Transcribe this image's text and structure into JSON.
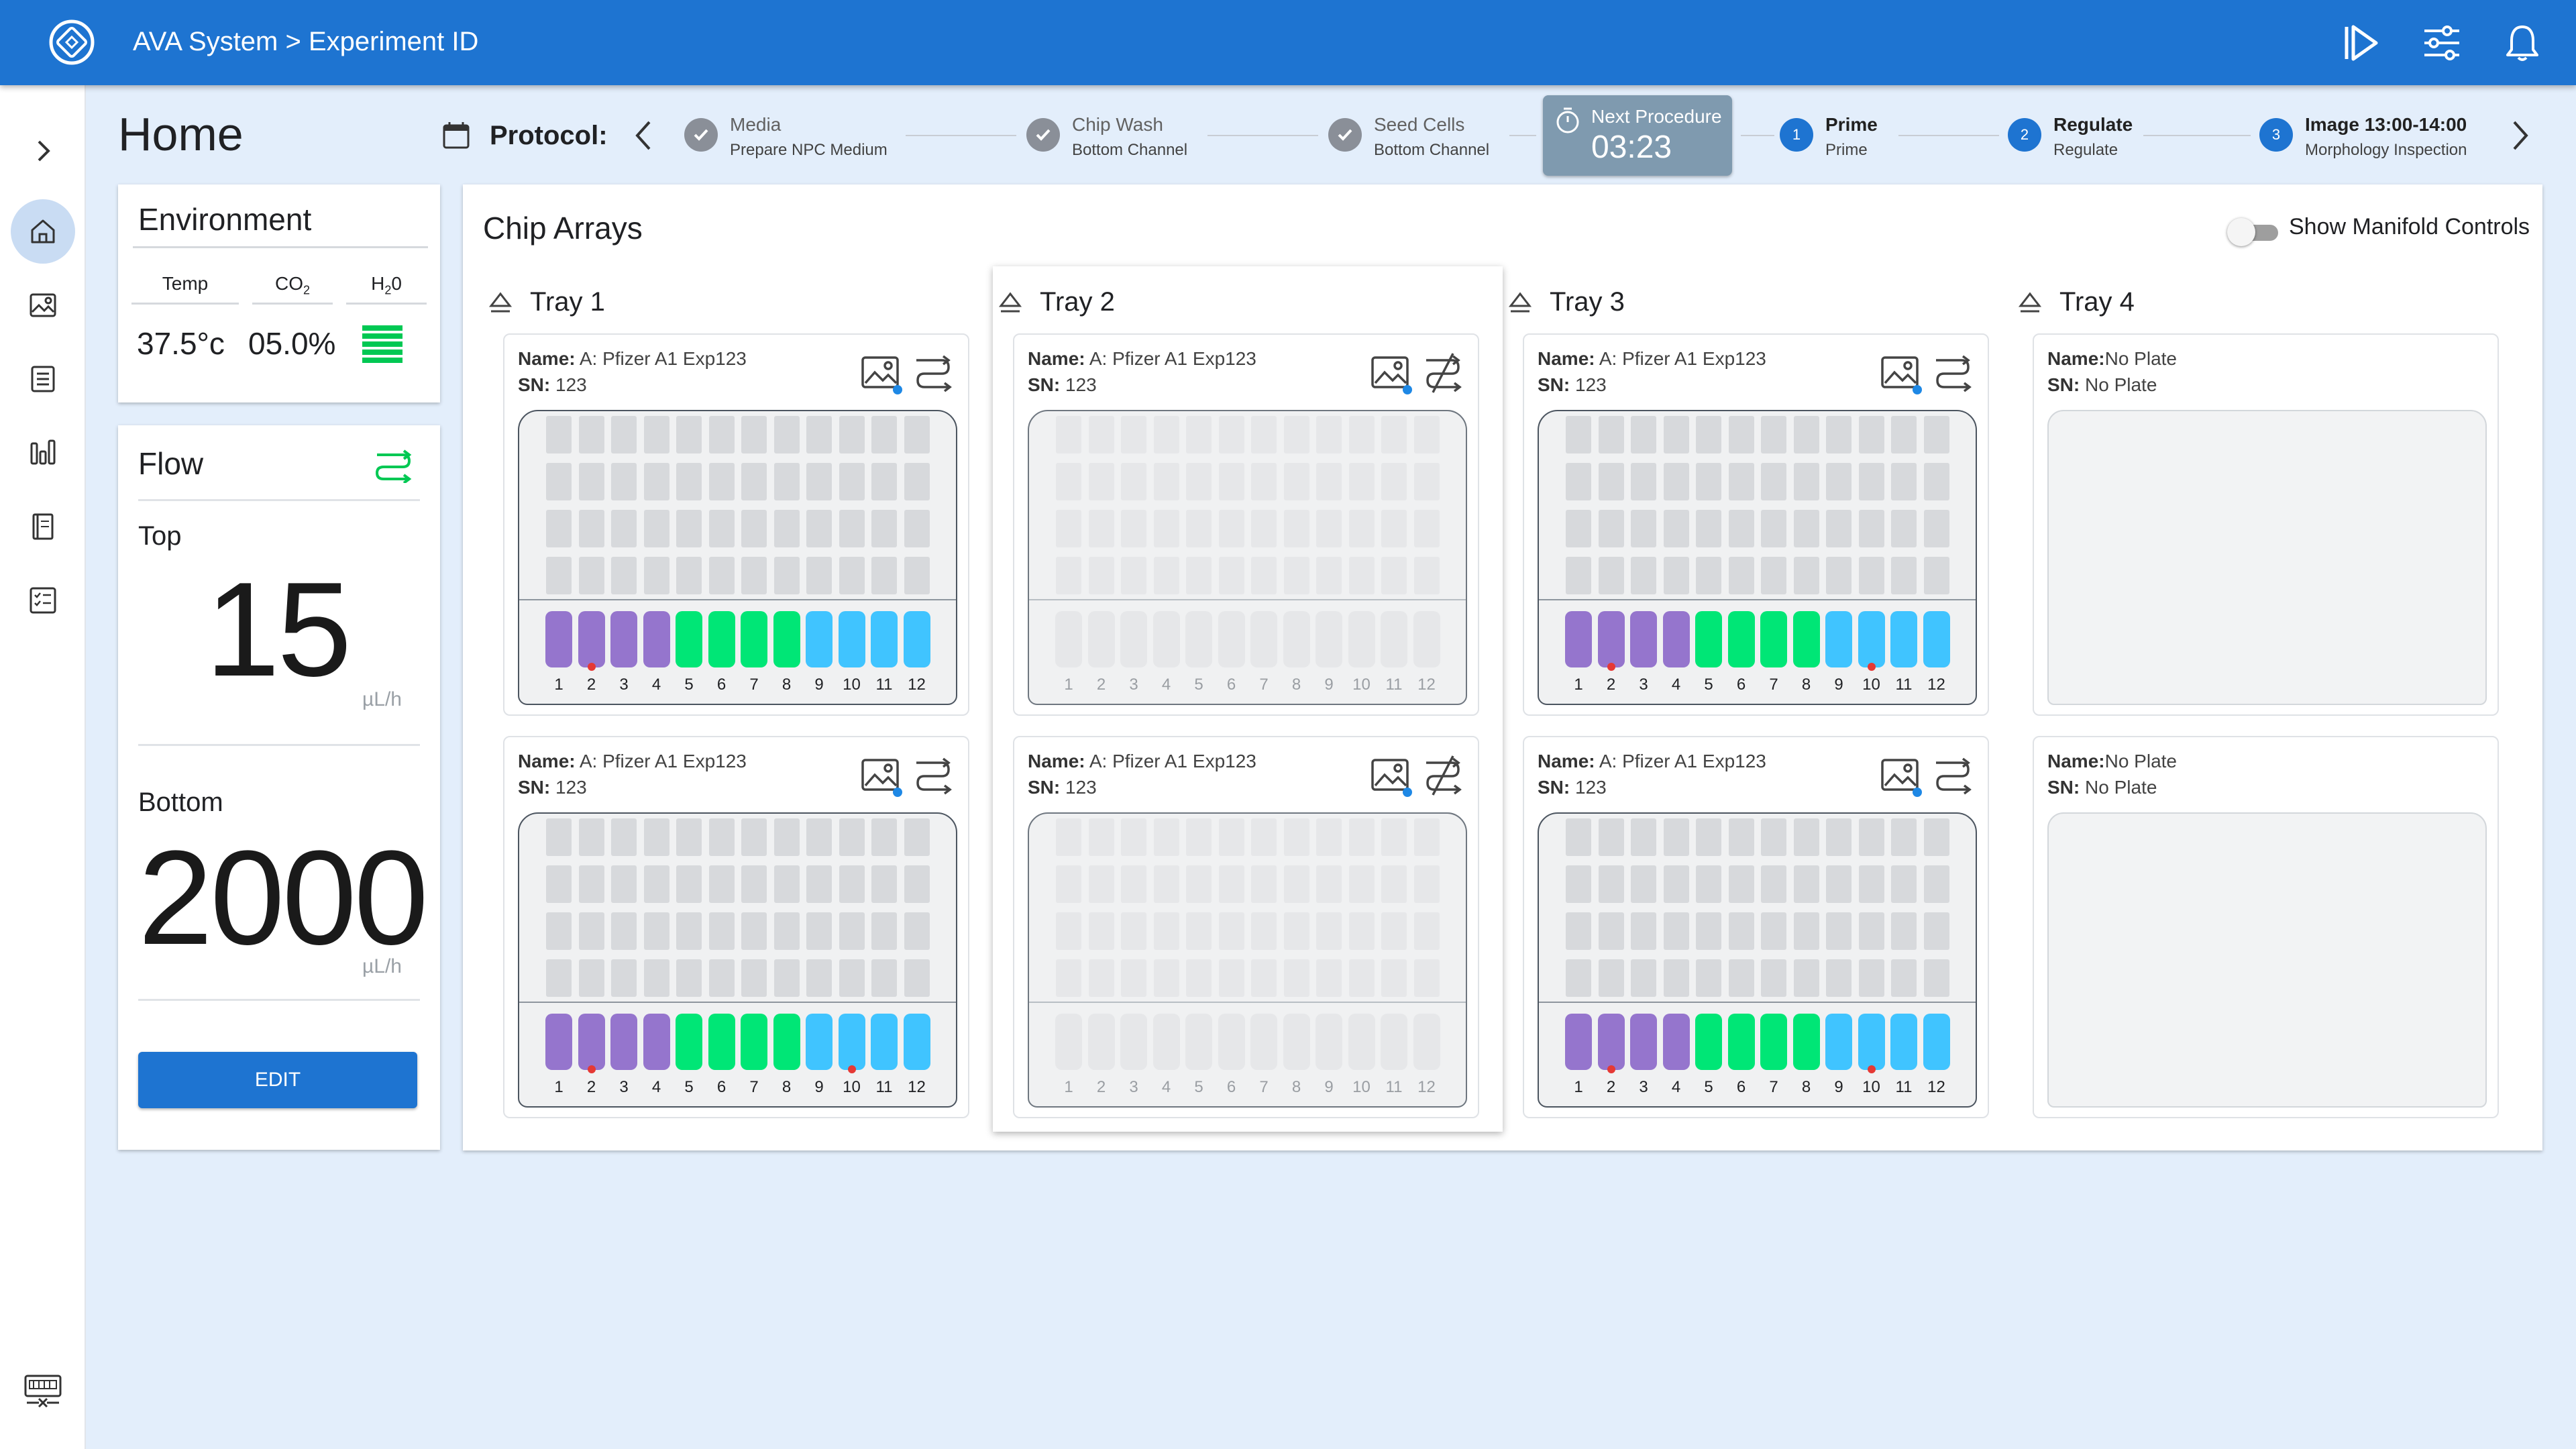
{
  "app": {
    "title": "AVA System > Experiment ID"
  },
  "page": {
    "title": "Home"
  },
  "protocol": {
    "label": "Protocol:",
    "steps": [
      {
        "title": "Media",
        "subtitle": "Prepare NPC Medium",
        "status": "done"
      },
      {
        "title": "Chip Wash",
        "subtitle": "Bottom Channel",
        "status": "done"
      },
      {
        "title": "Seed Cells",
        "subtitle": "Bottom Channel",
        "status": "done"
      },
      {
        "title": "Prime",
        "subtitle": "Prime",
        "status": "upcoming",
        "number": "1"
      },
      {
        "title": "Regulate",
        "subtitle": "Regulate",
        "status": "upcoming",
        "number": "2"
      },
      {
        "title": "Image 13:00-14:00",
        "subtitle": "Morphology Inspection",
        "status": "upcoming",
        "number": "3"
      }
    ],
    "next_procedure": {
      "label": "Next Procedure",
      "time": "03:23"
    }
  },
  "environment": {
    "title": "Environment",
    "temp_label": "Temp",
    "co2_label": "CO",
    "co2_sub": "2",
    "h2o_label": "H",
    "h2o_sub": "2",
    "h2o_label_end": "0",
    "temp_value": "37.5°c",
    "co2_value": "05.0%",
    "h2o_level": 1.0
  },
  "flow": {
    "title": "Flow",
    "top_label": "Top",
    "top_value": "15",
    "top_unit": "µL/h",
    "bottom_label": "Bottom",
    "bottom_value": "2000",
    "bottom_unit": "µL/h",
    "edit_label": "EDIT"
  },
  "chip_arrays": {
    "title": "Chip Arrays",
    "manifold_toggle_label": "Show Manifold Controls",
    "manifold_toggle_on": false,
    "channel_colors": {
      "purple": "#9575cd",
      "green": "#00e676",
      "blue": "#40c4ff",
      "inactive": "#e6e7e9"
    },
    "trays": [
      {
        "label": "Tray 1",
        "plates": [
          {
            "name_label": "Name:",
            "name": " A: Pfizer A1 Exp123",
            "sn_label": "SN:",
            "sn": " 123",
            "state": "active",
            "red_dots": [
              2
            ]
          },
          {
            "name_label": "Name:",
            "name": " A: Pfizer A1 Exp123",
            "sn_label": "SN:",
            "sn": " 123",
            "state": "active",
            "red_dots": [
              2,
              10
            ]
          }
        ]
      },
      {
        "label": "Tray 2",
        "plates": [
          {
            "name_label": "Name:",
            "name": " A: Pfizer A1 Exp123",
            "sn_label": "SN:",
            "sn": " 123",
            "state": "inactive",
            "red_dots": []
          },
          {
            "name_label": "Name:",
            "name": " A: Pfizer A1 Exp123",
            "sn_label": "SN:",
            "sn": " 123",
            "state": "inactive",
            "red_dots": []
          }
        ]
      },
      {
        "label": "Tray 3",
        "plates": [
          {
            "name_label": "Name:",
            "name": " A: Pfizer A1 Exp123",
            "sn_label": "SN:",
            "sn": " 123",
            "state": "active",
            "red_dots": [
              2,
              10
            ]
          },
          {
            "name_label": "Name:",
            "name": " A: Pfizer A1 Exp123",
            "sn_label": "SN:",
            "sn": " 123",
            "state": "active",
            "red_dots": [
              2,
              10
            ]
          }
        ]
      },
      {
        "label": "Tray 4",
        "plates": [
          {
            "name_label": "Name:",
            "name": "No Plate",
            "sn_label": "SN:",
            "sn": " No Plate",
            "state": "empty",
            "red_dots": []
          },
          {
            "name_label": "Name:",
            "name": "No Plate",
            "sn_label": "SN:",
            "sn": " No Plate",
            "state": "empty",
            "red_dots": []
          }
        ]
      }
    ],
    "channel_numbers": [
      "1",
      "2",
      "3",
      "4",
      "5",
      "6",
      "7",
      "8",
      "9",
      "10",
      "11",
      "12"
    ]
  }
}
